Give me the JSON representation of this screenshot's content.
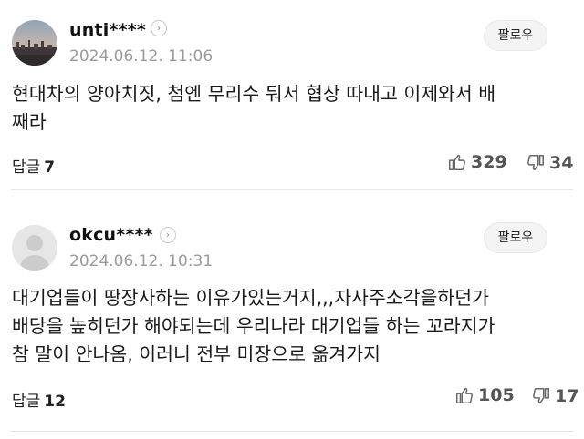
{
  "comments": [
    {
      "username": "unti****",
      "date": "2024.06.12. 11:06",
      "follow_label": "팔로우",
      "text": "현대차의 양아치짓, 첨엔 무리수 둬서 협상 따내고 이제와서 배\n째라",
      "reply_label": "답글",
      "reply_count": "7",
      "like_count": "329",
      "dislike_count": "34"
    },
    {
      "username": "okcu****",
      "date": "2024.06.12. 10:31",
      "follow_label": "팔로우",
      "text": "대기업들이 땅장사하는 이유가있는거지,,,자사주소각을하던가\n배당을 높히던가 해야되는데 우리나라 대기업들 하는 꼬라지가\n참 말이 안나옴, 이러니 전부 미장으로 옮겨가지",
      "reply_label": "답글",
      "reply_count": "12",
      "like_count": "105",
      "dislike_count": "17"
    }
  ]
}
